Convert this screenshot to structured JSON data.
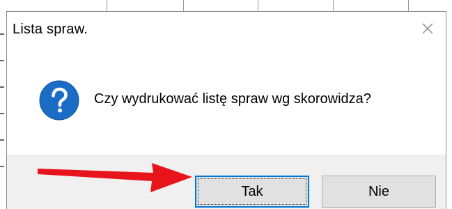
{
  "dialog": {
    "title": "Lista spraw.",
    "message": "Czy wydrukować listę spraw wg skorowidza?",
    "icon": "question-icon",
    "close_icon": "close-icon",
    "buttons": {
      "yes_label": "Tak",
      "no_label": "Nie"
    }
  },
  "annotation": {
    "icon": "red-arrow-icon",
    "color": "#e8141b"
  },
  "colors": {
    "question_icon_fill": "#1a6cc4",
    "focus_border": "#0078d7",
    "footer_bg": "#f0f0f0",
    "button_bg": "#e1e1e1"
  }
}
